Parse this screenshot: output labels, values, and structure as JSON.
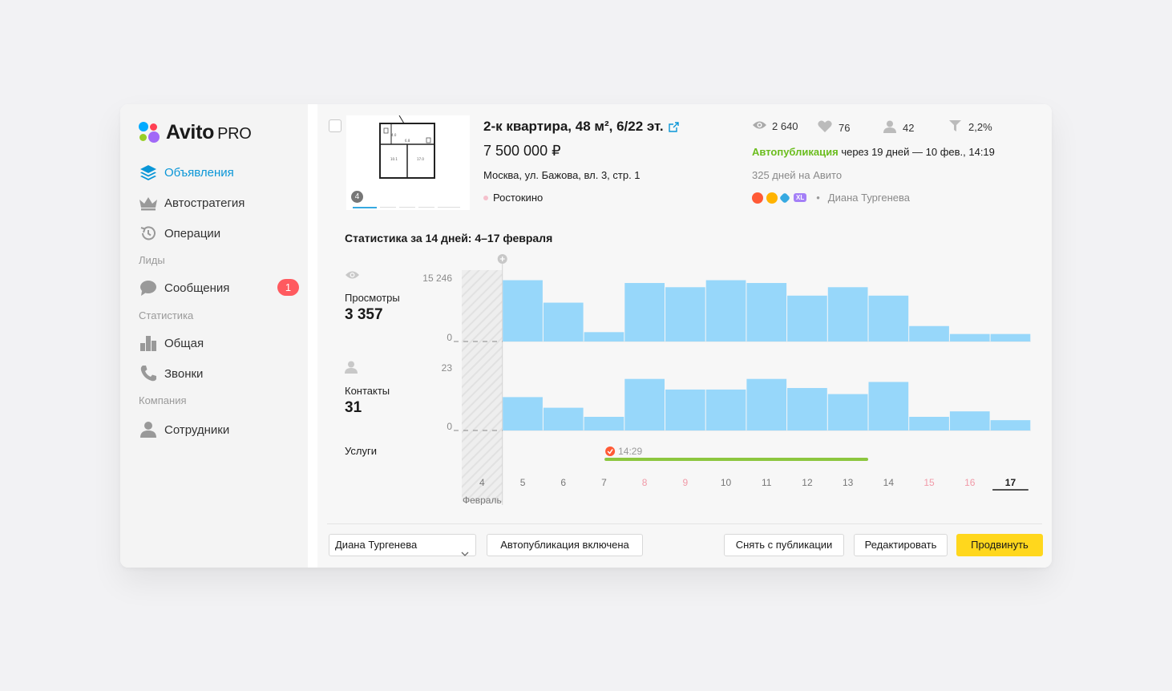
{
  "app": {
    "logo_text": "Avito",
    "logo_suffix": "PRO"
  },
  "sidebar": {
    "items": [
      {
        "label": "Объявления",
        "icon": "layers-icon",
        "active": true
      },
      {
        "label": "Автостратегия",
        "icon": "crown-icon"
      },
      {
        "label": "Операции",
        "icon": "history-icon"
      },
      {
        "label": "Сообщения",
        "icon": "chat-icon",
        "badge": "1"
      },
      {
        "label": "Общая",
        "icon": "bar-chart-icon"
      },
      {
        "label": "Звонки",
        "icon": "phone-icon"
      },
      {
        "label": "Сотрудники",
        "icon": "user-icon"
      }
    ],
    "sections": {
      "leads": "Лиды",
      "stats": "Статистика",
      "company": "Компания"
    }
  },
  "listing": {
    "photo_count": "4",
    "title": "2-к квартира, 48 м², 6/22 эт.",
    "price": "7 500 000 ₽",
    "address": "Москва, ул. Бажова, вл. 3, стр. 1",
    "metro": "Ростокино",
    "views": "2 640",
    "favorites": "76",
    "contacts": "42",
    "conversion": "2,2%",
    "autopub_label": "Автопубликация",
    "autopub_text": " через 19 дней — 10 фев., 14:19",
    "days_on_avito": "325 дней на Авито",
    "manager": "Диана Тургенева"
  },
  "stats": {
    "title": "Статистика за 14 дней: 4–17 февраля",
    "views_label": "Просмотры",
    "views_total": "3 357",
    "views_max_label": "15 246",
    "views_min_label": "0",
    "contacts_label": "Контакты",
    "contacts_total": "31",
    "contacts_max_label": "23",
    "contacts_min_label": "0",
    "services_label": "Услуги",
    "service_time": "14:29",
    "month_label": "Февраль"
  },
  "chart_data": {
    "type": "bar",
    "categories": [
      "4",
      "5",
      "6",
      "7",
      "8",
      "9",
      "10",
      "11",
      "12",
      "13",
      "14",
      "15",
      "16",
      "17"
    ],
    "weekend_days": [
      "8",
      "9",
      "15",
      "16"
    ],
    "selected_day": "17",
    "series": [
      {
        "name": "Просмотры",
        "ymax": 15246,
        "values": [
          null,
          13100,
          8300,
          2000,
          12500,
          11600,
          13100,
          12500,
          9800,
          11600,
          9800,
          3300,
          1600,
          1600
        ]
      },
      {
        "name": "Контакты",
        "ymax": 23,
        "values": [
          null,
          11,
          7.5,
          4.5,
          17,
          13.5,
          13.5,
          17,
          14,
          12,
          16,
          4.5,
          6.3,
          3.4
        ]
      }
    ],
    "service_bar": {
      "start_day": "7",
      "end_day": "13",
      "color": "#8cc63f"
    },
    "bar_color": "#97d7fa"
  },
  "footer": {
    "select_value": "Диана Тургенева",
    "autopub_button": "Автопубликация включена",
    "unpublish_button": "Снять с публикации",
    "edit_button": "Редактировать",
    "promote_button": "Продвинуть"
  }
}
